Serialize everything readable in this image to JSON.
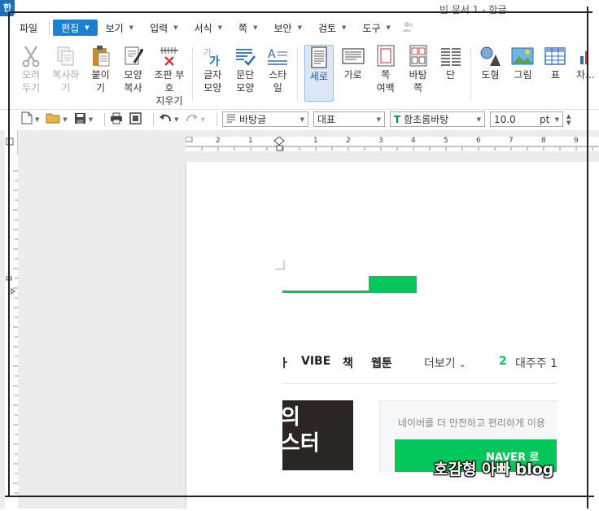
{
  "window": {
    "logo": "한",
    "title": "빈 문서 1 - 한글"
  },
  "menu": [
    {
      "label": "파일",
      "has_caret": false
    },
    {
      "label": "편집",
      "has_caret": true,
      "active": true
    },
    {
      "label": "보기",
      "has_caret": true
    },
    {
      "label": "입력",
      "has_caret": true
    },
    {
      "label": "서식",
      "has_caret": true
    },
    {
      "label": "쪽",
      "has_caret": true
    },
    {
      "label": "보안",
      "has_caret": true
    },
    {
      "label": "검토",
      "has_caret": true
    },
    {
      "label": "도구",
      "has_caret": true
    }
  ],
  "ribbon": {
    "cut": "오려\n두기",
    "copy": "복사하기",
    "paste": "붙이기",
    "format_copy": "모양\n복사",
    "clear_format": "조판 부호\n지우기",
    "char_shape": "글자\n모양",
    "para_shape": "문단\n모양",
    "style": "스타일",
    "portrait": "세로",
    "landscape": "가로",
    "margins": "쪽\n여백",
    "background": "바탕쪽",
    "columns": "단",
    "shapes": "도형",
    "picture": "그림",
    "table": "표",
    "chart": "차..."
  },
  "toolbar": {
    "style_combo": "바탕글",
    "lang_combo": "대표",
    "font_combo": "함초롬바탕",
    "size_value": "10.0",
    "size_unit": "pt"
  },
  "ruler": {
    "labels": [
      "2",
      "1",
      "1",
      "2",
      "3",
      "4",
      "5",
      "6",
      "7",
      "8",
      "9"
    ]
  },
  "page_capture": {
    "nav_items": [
      "VIBE",
      "책",
      "웹툰"
    ],
    "nav_partial": "ㅏ",
    "more_label": "더보기",
    "rank_number": "2",
    "rank_text": "대주주 1",
    "thumb_line1": "의",
    "thumb_line2": "스터",
    "login_notice": "네이버를 더 안전하고 편리하게 이용",
    "login_button_text": "NAVER 로"
  },
  "watermark": "호감형 아빠 blog",
  "colors": {
    "accent": "#1d7fd1",
    "naver_green": "#03c75a"
  }
}
